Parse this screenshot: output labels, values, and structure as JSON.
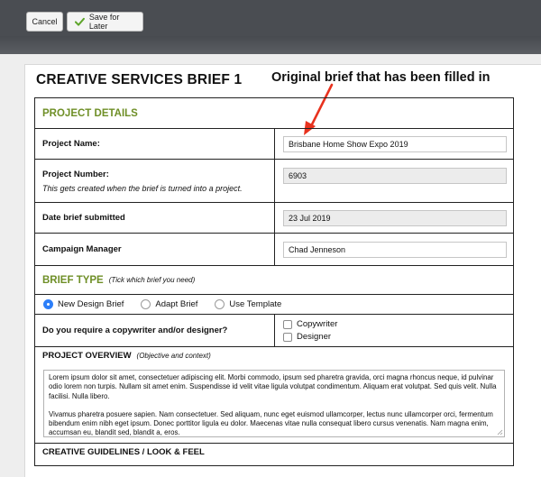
{
  "toolbar": {
    "cancel_label": "Cancel",
    "save_label": "Save for Later",
    "save_icon": "checkmark-icon"
  },
  "brief": {
    "title": "CREATIVE SERVICES BRIEF 1"
  },
  "annotation": {
    "text": "Original brief that has been filled in",
    "color": "#e8321e"
  },
  "colors": {
    "section_green": "#6f8f27",
    "radio_blue": "#2d7ff9"
  },
  "project_details": {
    "heading": "PROJECT DETAILS",
    "name_label": "Project Name:",
    "name_value": "Brisbane Home Show Expo 2019",
    "number_label": "Project Number:",
    "number_note": "This gets created when the brief is turned into a project.",
    "number_value": "6903",
    "date_label": "Date brief submitted",
    "date_value": "23 Jul 2019",
    "manager_label": "Campaign Manager",
    "manager_value": "Chad Jenneson"
  },
  "brief_type": {
    "heading": "BRIEF TYPE",
    "hint": "(Tick which brief you need)",
    "options": [
      "New Design Brief",
      "Adapt Brief",
      "Use Template"
    ],
    "selected": "New Design Brief",
    "copy_question": "Do you require a copywriter and/or designer?",
    "copywriter_label": "Copywriter",
    "designer_label": "Designer"
  },
  "overview": {
    "heading": "PROJECT OVERVIEW",
    "hint": "(Objective and context)",
    "para1": "Lorem ipsum dolor sit amet, consectetuer adipiscing elit. Morbi commodo, ipsum sed pharetra gravida, orci magna rhoncus neque, id pulvinar odio lorem non turpis. Nullam sit amet enim. Suspendisse id velit vitae ligula volutpat condimentum. Aliquam erat volutpat. Sed quis velit. Nulla facilisi. Nulla libero.",
    "para2": "Vivamus pharetra posuere sapien. Nam consectetuer. Sed aliquam, nunc eget euismod ullamcorper, lectus nunc ullamcorper orci, fermentum bibendum enim nibh eget ipsum. Donec porttitor ligula eu dolor. Maecenas vitae nulla consequat libero cursus venenatis. Nam magna enim, accumsan eu, blandit sed, blandit a, eros."
  },
  "guidelines": {
    "heading": "CREATIVE GUIDELINES / LOOK & FEEL"
  }
}
